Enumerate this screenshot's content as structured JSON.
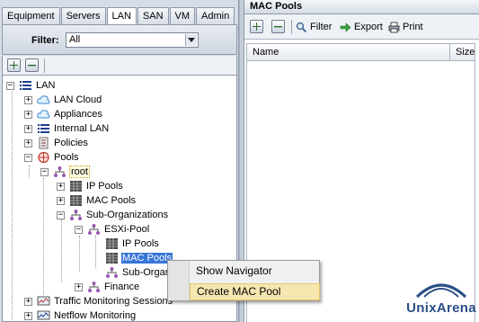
{
  "tabs": [
    {
      "label": "Equipment",
      "active": false
    },
    {
      "label": "Servers",
      "active": false
    },
    {
      "label": "LAN",
      "active": true
    },
    {
      "label": "SAN",
      "active": false
    },
    {
      "label": "VM",
      "active": false
    },
    {
      "label": "Admin",
      "active": false
    }
  ],
  "filter": {
    "label": "Filter:",
    "value": "All"
  },
  "tree": {
    "lan": "LAN",
    "lan_cloud": "LAN Cloud",
    "appliances": "Appliances",
    "internal_lan": "Internal LAN",
    "policies": "Policies",
    "pools": "Pools",
    "root": "root",
    "ip_pools": "IP Pools",
    "mac_pools": "MAC Pools",
    "sub_orgs": "Sub-Organizations",
    "esxi_pool": "ESXi-Pool",
    "esxi_ip_pools": "IP Pools",
    "esxi_mac_pools": "MAC Pools",
    "esxi_sub_org": "Sub-Organ",
    "finance": "Finance",
    "traffic_monitoring": "Traffic Monitoring Sessions",
    "netflow_monitoring": "Netflow Monitoring"
  },
  "right_panel": {
    "title": "MAC Pools",
    "filter_label": "Filter",
    "export_label": "Export",
    "print_label": "Print",
    "columns": [
      "Name",
      "Size"
    ]
  },
  "context_menu": {
    "items": [
      "Show Navigator",
      "Create MAC Pool"
    ],
    "highlighted": "Create MAC Pool"
  },
  "logo": {
    "text": "UnixArena",
    "color": "#2a4f86"
  },
  "colors": {
    "selection": "#3875d7",
    "menu_highlight": "#f6e7b0",
    "panel_bg": "#d6dde8"
  }
}
